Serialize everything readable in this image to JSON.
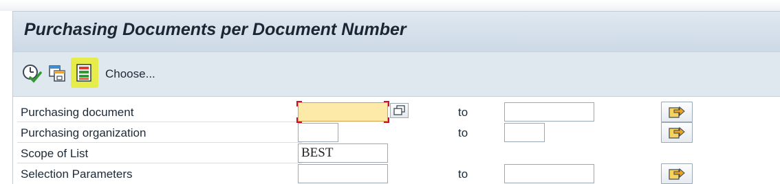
{
  "window": {
    "title": "Purchasing Documents per Document Number"
  },
  "toolbar": {
    "execute_icon": "execute-clock-check-icon",
    "variant_icon": "get-variant-icon",
    "layout_icon": "layout-list-icon",
    "choose_label": "Choose..."
  },
  "selection": {
    "to_label": "to",
    "rows": [
      {
        "label": "Purchasing document",
        "from_value": "",
        "to_value": "",
        "has_range": true,
        "has_multiple": true
      },
      {
        "label": "Purchasing organization",
        "from_value": "",
        "to_value": "",
        "has_range": true,
        "has_multiple": true
      },
      {
        "label": "Scope of List",
        "value": "BEST"
      },
      {
        "label": "Selection Parameters",
        "from_value": "",
        "to_value": "",
        "has_range": true,
        "has_multiple": true
      }
    ]
  },
  "colors": {
    "title_bar": "#ccd9e6",
    "toolbar": "#dfe7ef",
    "required_field": "#fde9a8",
    "arrow_button_fill": "#f6d35a",
    "required_marker": "#c8102e"
  }
}
